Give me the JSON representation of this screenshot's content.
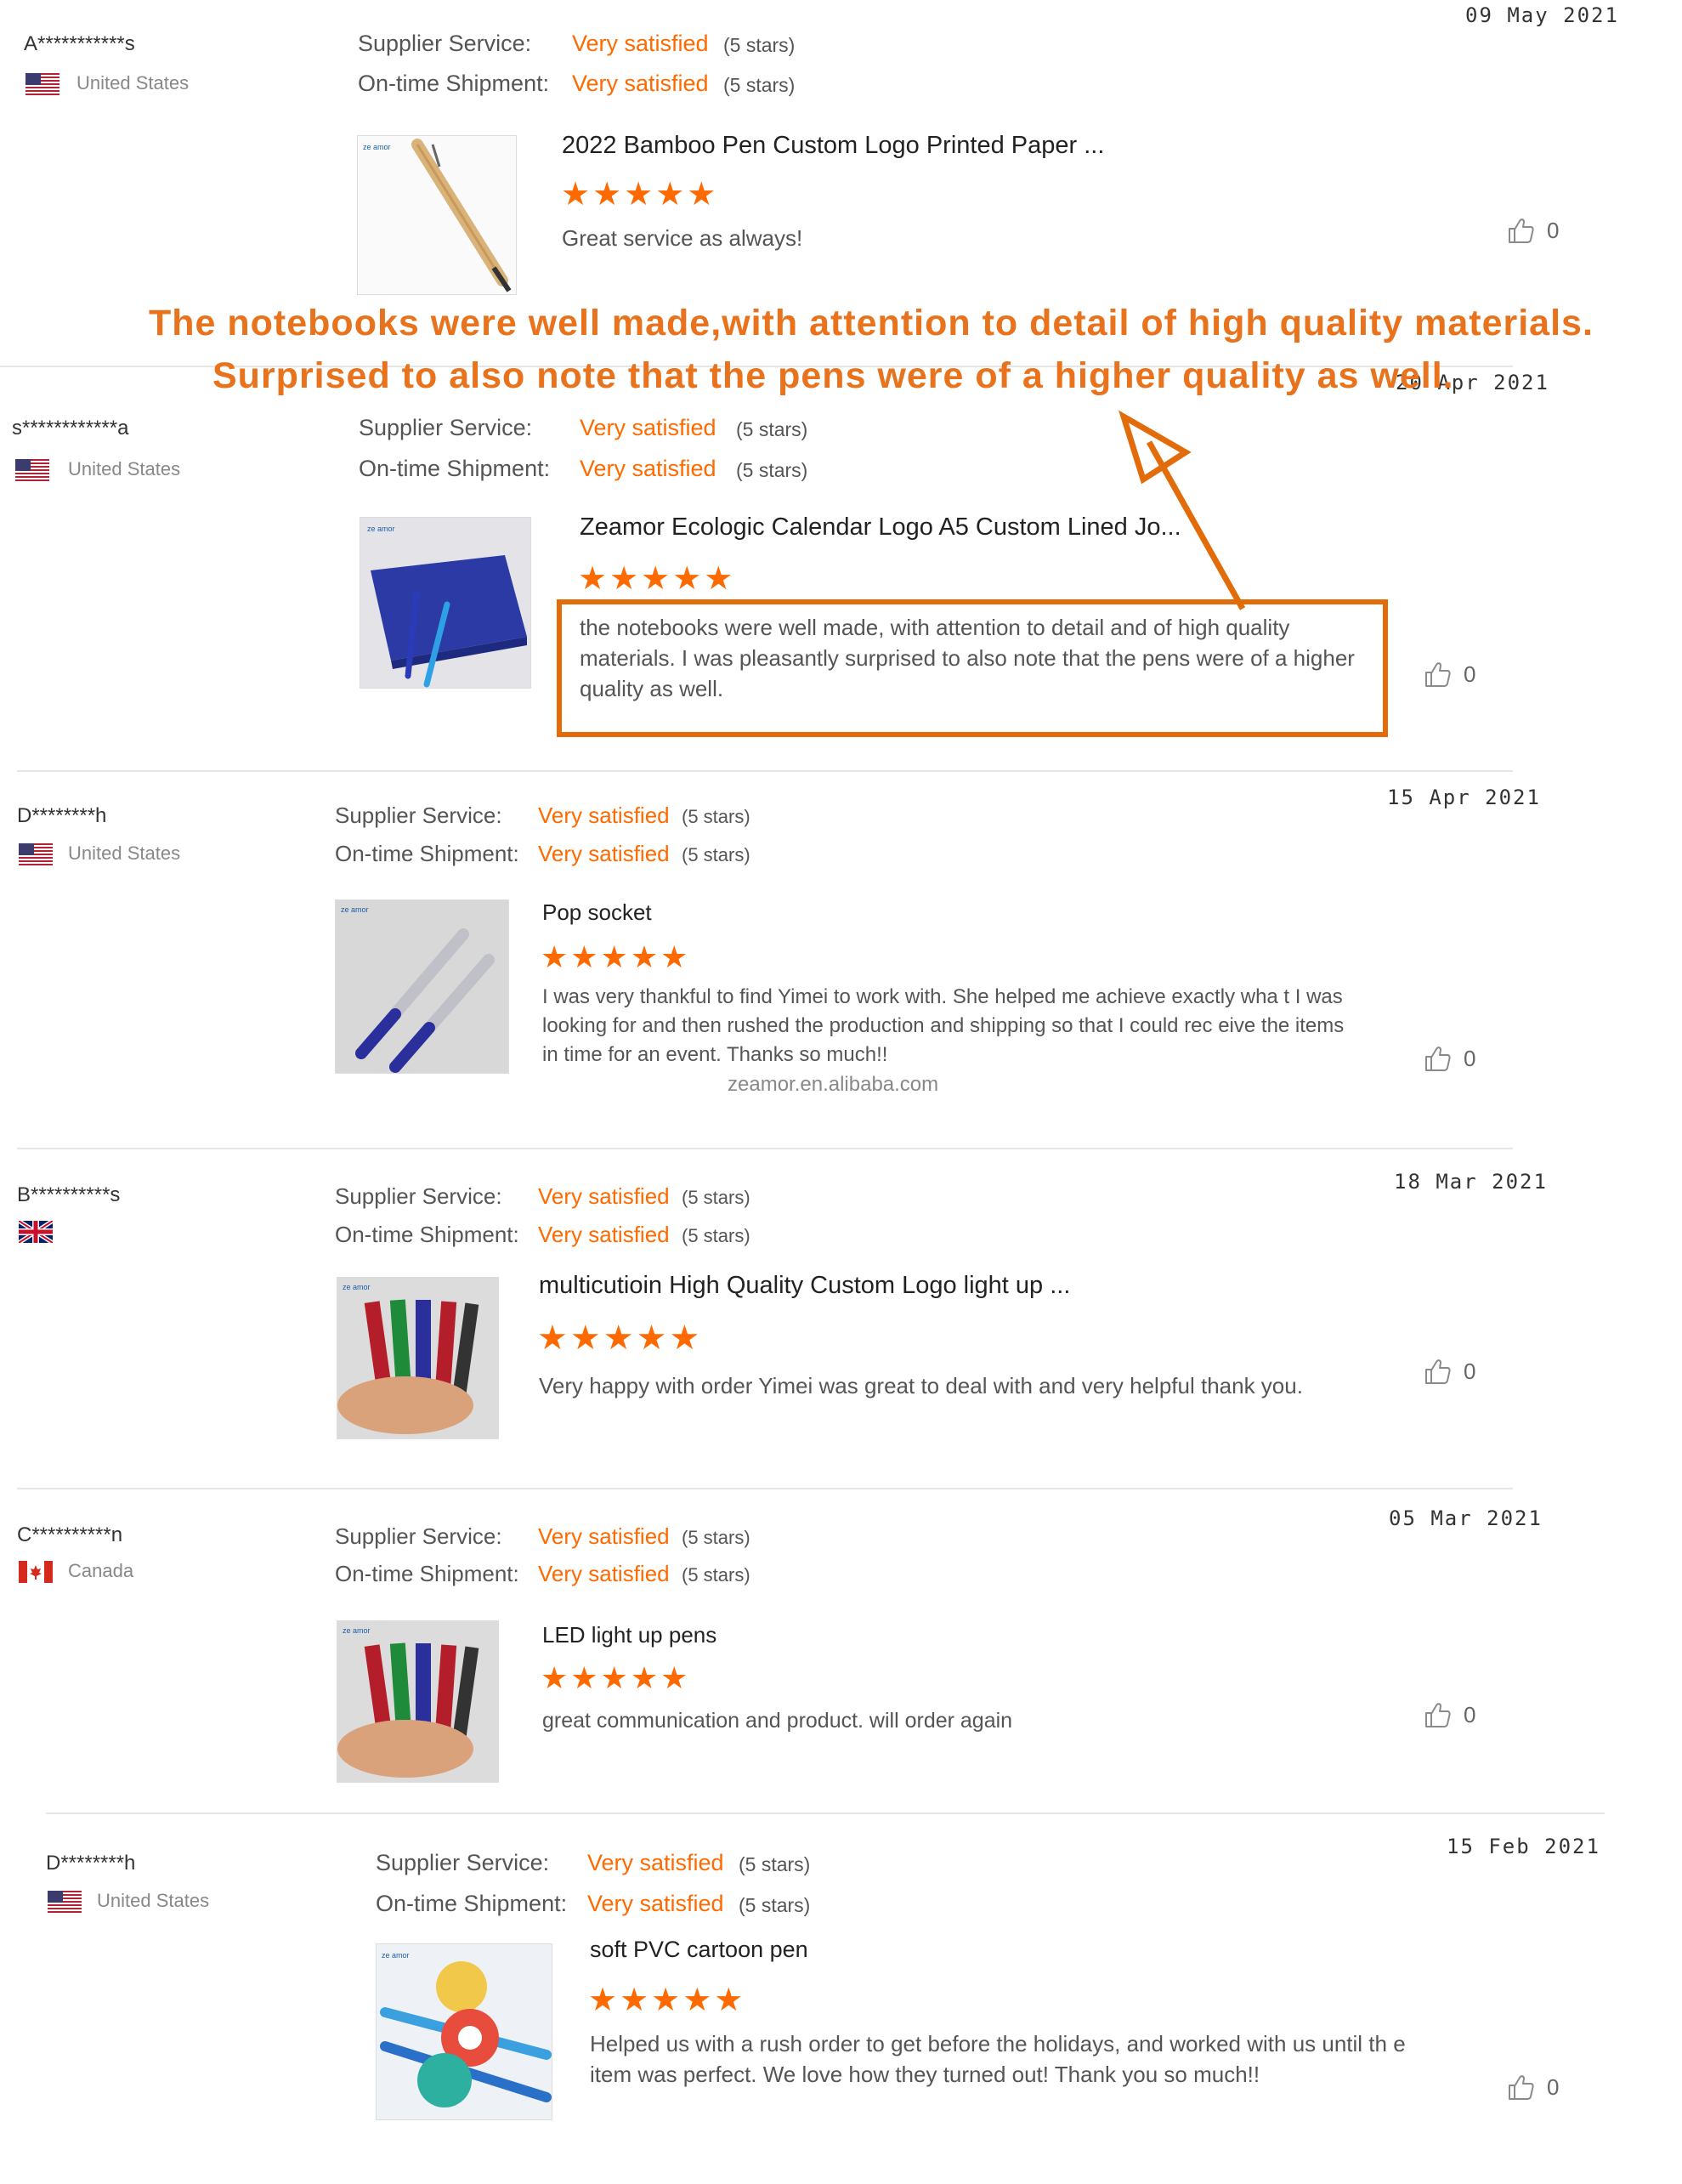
{
  "labels": {
    "supplier": "Supplier Service:",
    "shipment": "On-time Shipment:",
    "satisfied": "Very satisfied",
    "stars_note": "(5 stars)",
    "stars": "★★★★★"
  },
  "annotation": {
    "line1": "The notebooks were well made,with attention to detail of high quality materials.",
    "line2": "Surprised to also note that the pens were of a higher quality as well."
  },
  "watermark": "zeamor.en.alibaba.com",
  "reviews": [
    {
      "buyer": "A***********s",
      "country": "United States",
      "date": "09 May 2021",
      "title": "2022 Bamboo Pen Custom Logo Printed Paper ...",
      "comment": "Great service as always!",
      "likes": "0"
    },
    {
      "buyer": "s************a",
      "country": "United States",
      "date": "20 Apr 2021",
      "title": "Zeamor Ecologic Calendar Logo A5 Custom Lined Jo...",
      "comment": "the notebooks were well made, with attention to detail and of high quality materials. I was pleasantly surprised to also note that the pens were of a higher quality as well.",
      "likes": "0"
    },
    {
      "buyer": "D********h",
      "country": "United States",
      "date": "15 Apr 2021",
      "title": "Pop socket",
      "comment": "I was very thankful to find Yimei to work with. She helped me achieve exactly wha t I was looking for and then rushed the production and shipping so that I could rec eive the items in time for an event. Thanks so much!!",
      "likes": "0"
    },
    {
      "buyer": "B**********s",
      "country": "",
      "date": "18 Mar 2021",
      "title": "multicutioin High Quality Custom Logo light up ...",
      "comment": "Very happy with order Yimei was great to deal with and very helpful thank you.",
      "likes": "0"
    },
    {
      "buyer": "C**********n",
      "country": "Canada",
      "date": "05 Mar 2021",
      "title": "LED light up pens",
      "comment": "great communication and product. will order again",
      "likes": "0"
    },
    {
      "buyer": "D********h",
      "country": "United States",
      "date": "15 Feb 2021",
      "title": "soft PVC cartoon pen",
      "comment": "Helped us with a rush order to get before the holidays, and worked with us until th e item was perfect. We love how they turned out! Thank you so much!!",
      "likes": "0"
    }
  ]
}
